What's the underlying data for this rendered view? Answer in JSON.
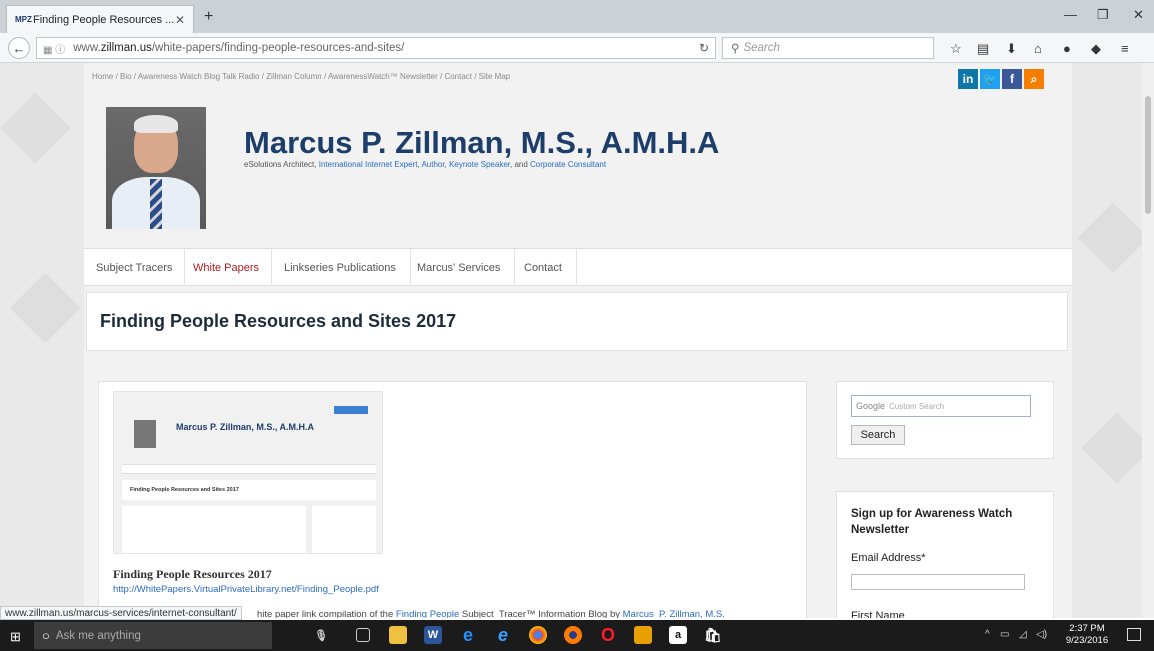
{
  "browser": {
    "tab_title": "Finding People Resources ...",
    "tab_favicon": "MPZ",
    "url_prefix": "www.",
    "url_host": "zillman.us",
    "url_path": "/white-papers/finding-people-resources-and-sites/",
    "search_placeholder": "Search"
  },
  "site": {
    "top_nav": "Home / Bio / Awareness Watch Blog Talk Radio / Zillman Column / AwarenessWatch™ Newsletter / Contact / Site Map",
    "name": "Marcus P. Zillman, M.S., A.M.H.A",
    "tagline_start": "eSolutions Architect, ",
    "tagline_link1": "International Internet Expert",
    "tagline_sep1": ", ",
    "tagline_link2": "Author",
    "tagline_sep2": ", ",
    "tagline_link3": "Keynote Speaker",
    "tagline_sep3": ", and ",
    "tagline_link4": "Corporate Consultant",
    "social": [
      "in",
      "🐦",
      "f",
      "⌕"
    ],
    "menu": [
      "Subject Tracers",
      "White Papers",
      "Linkseries Publications",
      "Marcus' Services",
      "Contact"
    ],
    "active_menu": "White Papers"
  },
  "page": {
    "title": "Finding People Resources and Sites 2017",
    "doc_title": "Finding People Resources 2017",
    "doc_link": "http://WhitePapers.VirtualPrivateLibrary.net/Finding_People.pdf",
    "desc_start": "hite paper link compilation of the ",
    "desc_link1": "Finding People",
    "desc_mid": " Subject_Tracer™ Information Blog by ",
    "desc_link2": "Marcus_P. Zillman, M.S.",
    "thumb_name": "Marcus P. Zillman, M.S., A.M.H.A",
    "thumb_title": "Finding People Resources and Sites 2017"
  },
  "sidebar": {
    "search_placeholder": "Custom Search",
    "google_label": "Google",
    "search_button": "Search",
    "newsletter_heading": "Sign up for Awareness Watch Newsletter",
    "email_label": "Email Address*",
    "first_name_label": "First Name"
  },
  "status_url": "www.zillman.us/marcus-services/internet-consultant/",
  "taskbar": {
    "cortana_text": "Ask me anything",
    "time": "2:37 PM",
    "date": "9/23/2016"
  },
  "colors": {
    "site_name": "#1d3d6b",
    "link": "#2a6cc2",
    "active_menu": "#b01c1c",
    "linkedin": "#0e76a8",
    "twitter": "#1da1f2",
    "facebook": "#3b5998",
    "rss": "#f57d00"
  }
}
